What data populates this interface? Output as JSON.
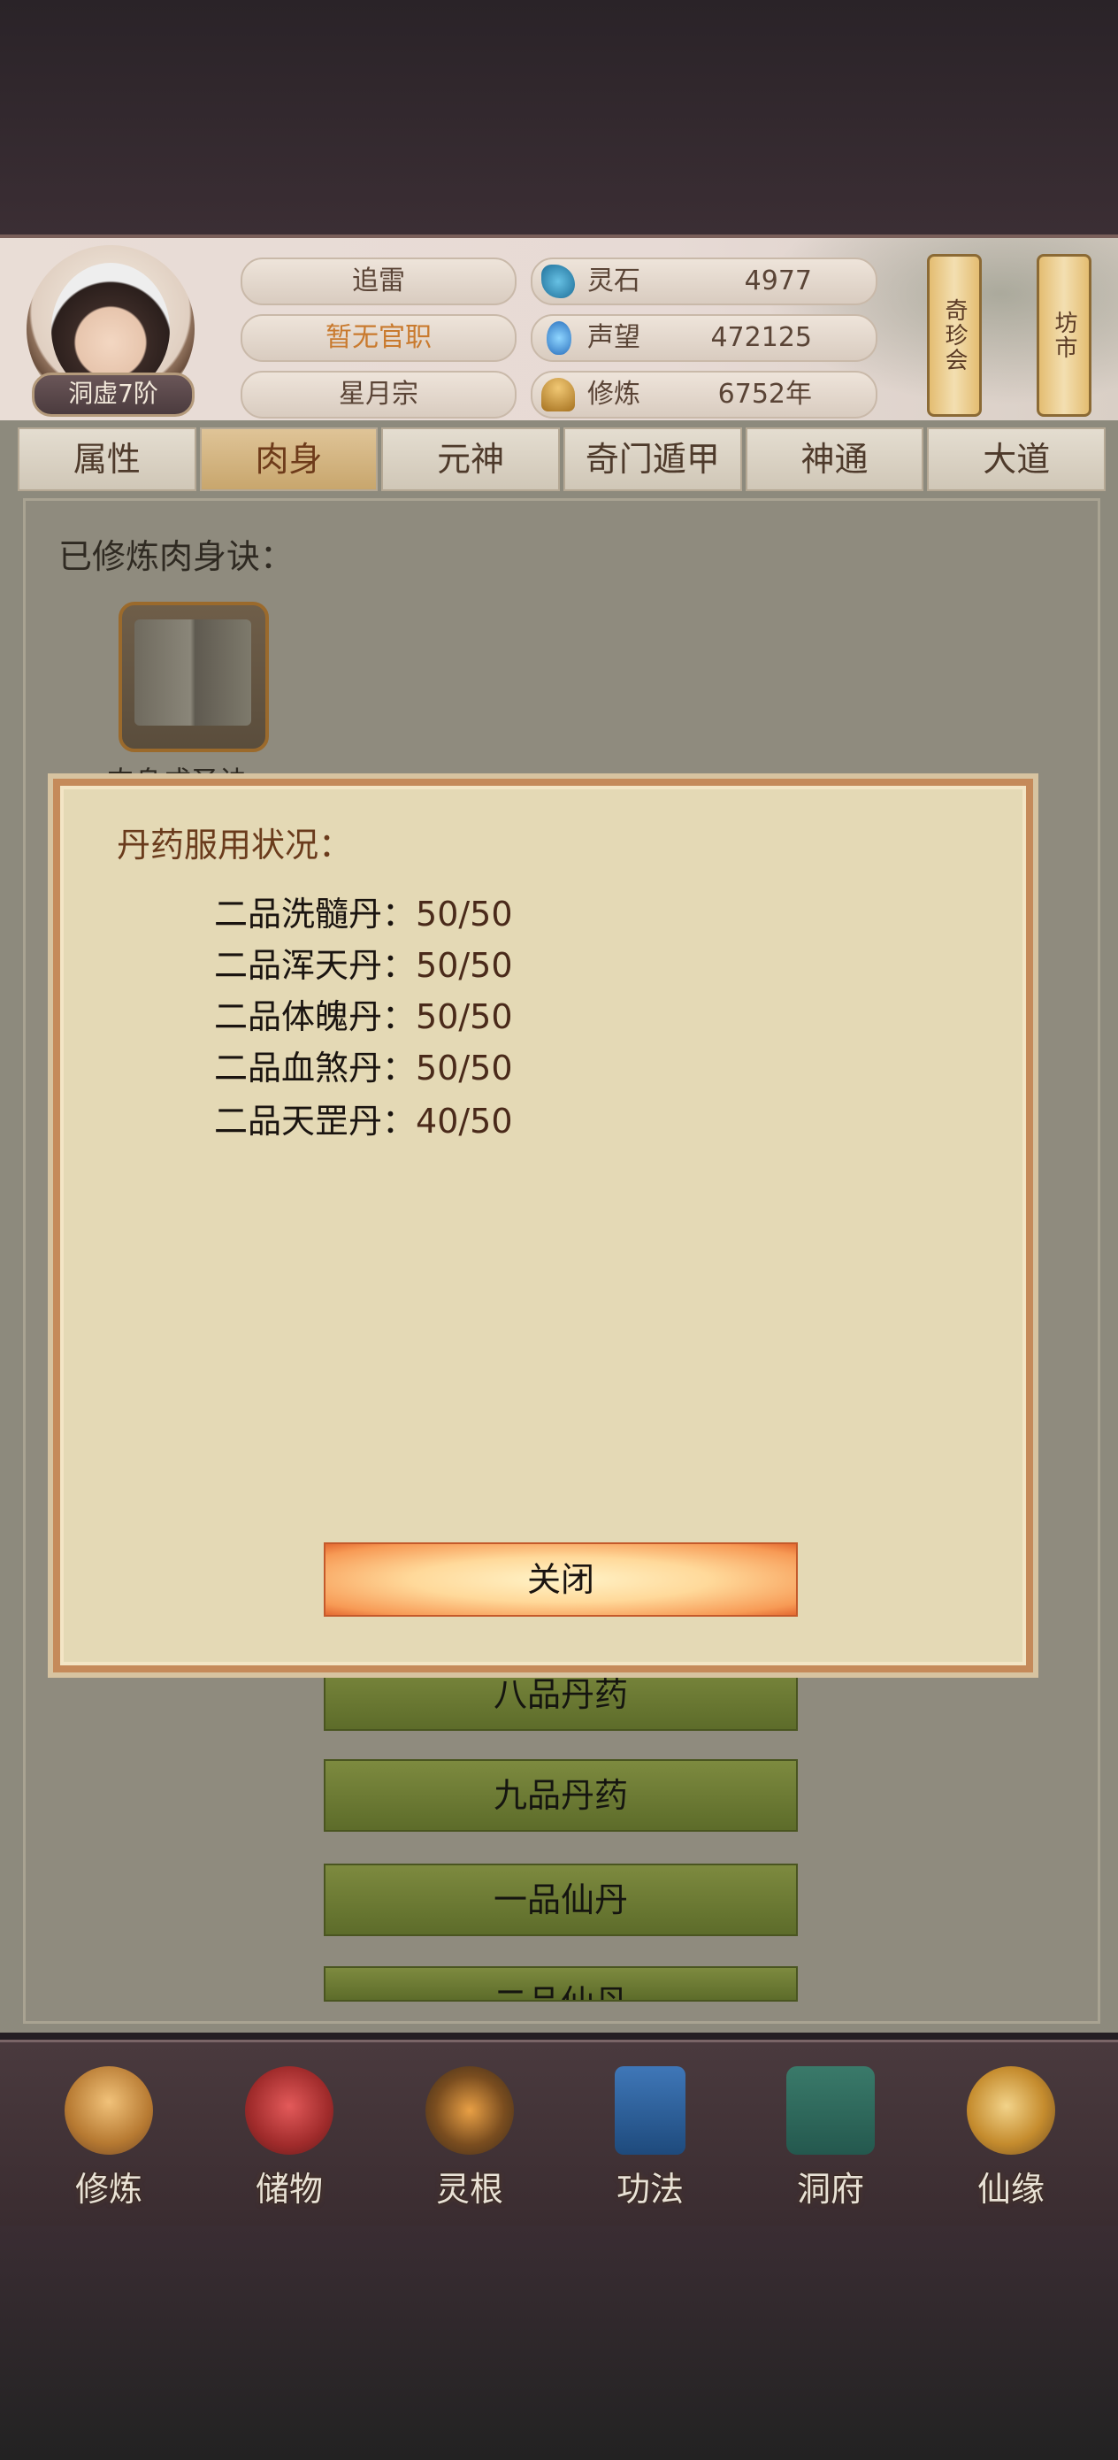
{
  "header": {
    "rank_badge": "洞虚7阶",
    "name": "追雷",
    "official_title": "暂无官职",
    "sect": "星月宗",
    "stats": [
      {
        "label": "灵石",
        "value": "4977",
        "icon": "spirit-stone-icon"
      },
      {
        "label": "声望",
        "value": "472125",
        "icon": "reputation-icon"
      },
      {
        "label": "修炼",
        "value": "6752年",
        "icon": "cultivation-icon"
      }
    ],
    "side_scrolls": [
      "奇珍会",
      "坊市"
    ]
  },
  "tabs": [
    {
      "label": "属性",
      "active": false
    },
    {
      "label": "肉身",
      "active": true
    },
    {
      "label": "元神",
      "active": false
    },
    {
      "label": "奇门遁甲",
      "active": false
    },
    {
      "label": "神通",
      "active": false
    },
    {
      "label": "大道",
      "active": false
    }
  ],
  "content": {
    "learned_label": "已修炼肉身诀：",
    "book_caption": "肉身成圣诀",
    "pill_buttons": [
      "八品丹药",
      "九品丹药",
      "一品仙丹",
      "二品仙丹"
    ]
  },
  "modal": {
    "title": "丹药服用状况：",
    "rows": [
      {
        "name": "二品洗髓丹：",
        "count": "50/50"
      },
      {
        "name": "二品浑天丹：",
        "count": "50/50"
      },
      {
        "name": "二品体魄丹：",
        "count": "50/50"
      },
      {
        "name": "二品血煞丹：",
        "count": "50/50"
      },
      {
        "name": "二品天罡丹：",
        "count": "40/50"
      }
    ],
    "close_label": "关闭"
  },
  "nav": [
    {
      "label": "修炼",
      "icon": "cultivate-icon"
    },
    {
      "label": "储物",
      "icon": "storage-bag-icon"
    },
    {
      "label": "灵根",
      "icon": "spirit-root-icon"
    },
    {
      "label": "功法",
      "icon": "technique-book-icon"
    },
    {
      "label": "洞府",
      "icon": "cave-dwelling-icon"
    },
    {
      "label": "仙缘",
      "icon": "immortal-fate-icon"
    }
  ]
}
